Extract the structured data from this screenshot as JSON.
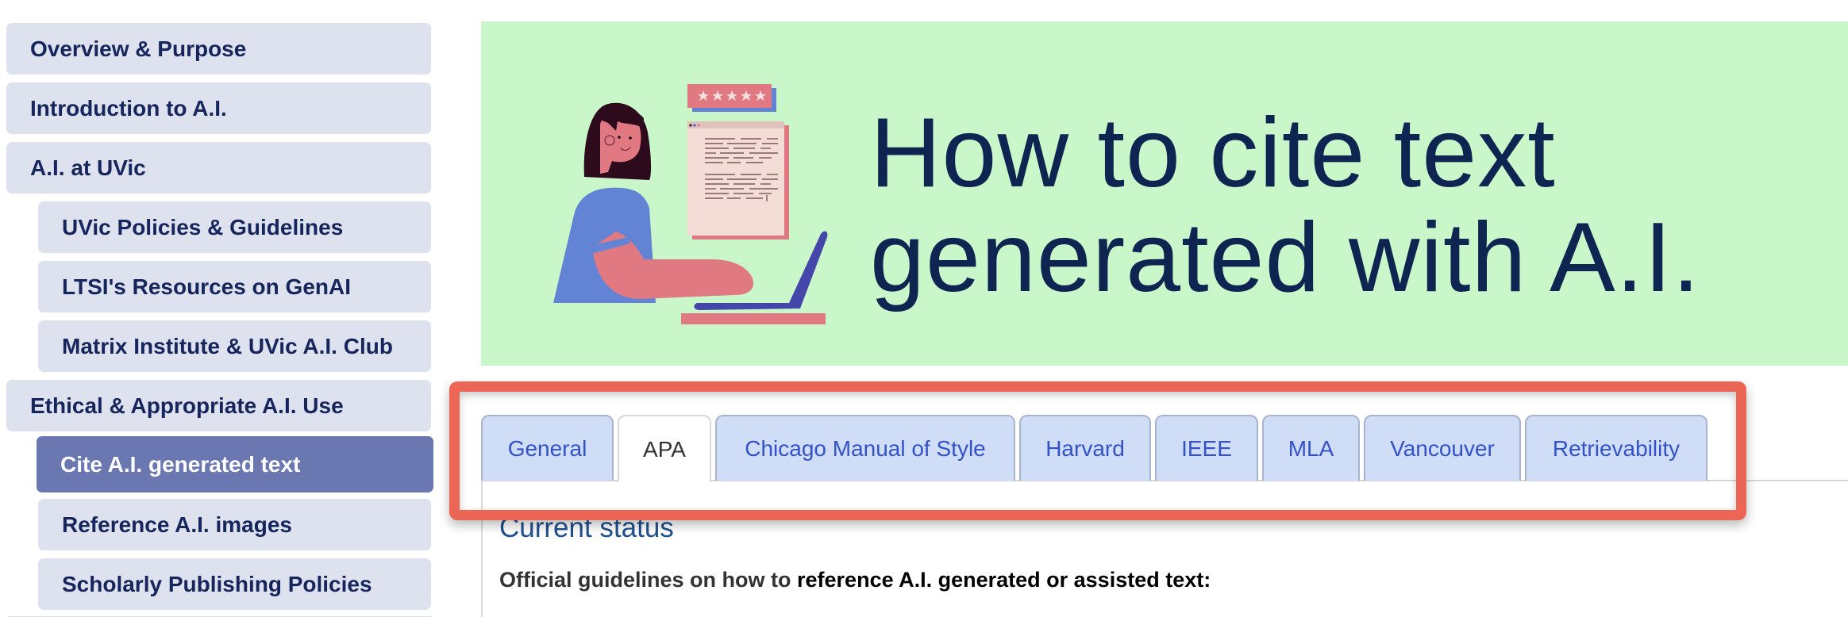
{
  "sidebar": {
    "items": [
      {
        "label": "Overview & Purpose",
        "level": 1,
        "active": false
      },
      {
        "label": "Introduction to A.I.",
        "level": 1,
        "active": false
      },
      {
        "label": "A.I. at UVic",
        "level": 1,
        "active": false
      },
      {
        "label": "UVic Policies & Guidelines",
        "level": 2,
        "active": false
      },
      {
        "label": "LTSI's Resources on GenAI",
        "level": 2,
        "active": false
      },
      {
        "label": "Matrix Institute & UVic A.I. Club",
        "level": 2,
        "active": false
      },
      {
        "label": "Ethical & Appropriate A.I. Use",
        "level": 1,
        "active": false
      },
      {
        "label": "Cite A.I. generated text",
        "level": 2,
        "active": true
      },
      {
        "label": "Reference A.I. images",
        "level": 2,
        "active": false
      },
      {
        "label": "Scholarly Publishing Policies",
        "level": 2,
        "active": false
      }
    ]
  },
  "banner": {
    "title_line1": "How to cite text",
    "title_line2": "generated with A.I.",
    "illustration": "person-typing-on-laptop-with-document-and-five-star-rating",
    "rating_stars": 5,
    "background_color": "#c9f7ca",
    "title_color": "#0e2551"
  },
  "tabs": [
    {
      "label": "General",
      "active": false
    },
    {
      "label": "APA",
      "active": true
    },
    {
      "label": "Chicago Manual of Style",
      "active": false
    },
    {
      "label": "Harvard",
      "active": false
    },
    {
      "label": "IEEE",
      "active": false
    },
    {
      "label": "MLA",
      "active": false
    },
    {
      "label": "Vancouver",
      "active": false
    },
    {
      "label": "Retrievability",
      "active": false
    }
  ],
  "content": {
    "heading": "Current status",
    "paragraph_prefix": "Official guidelines on how to ",
    "paragraph_emphasis": "reference A.I. generated or assisted text:"
  },
  "colors": {
    "sidebar_item_bg": "#dee1ee",
    "sidebar_active_bg": "#6b77b1",
    "sidebar_text": "#16255c",
    "tab_bg": "#d0ddf7",
    "tab_text": "#3352c8",
    "heading_text": "#1f5190",
    "highlight": "#eb6655"
  }
}
